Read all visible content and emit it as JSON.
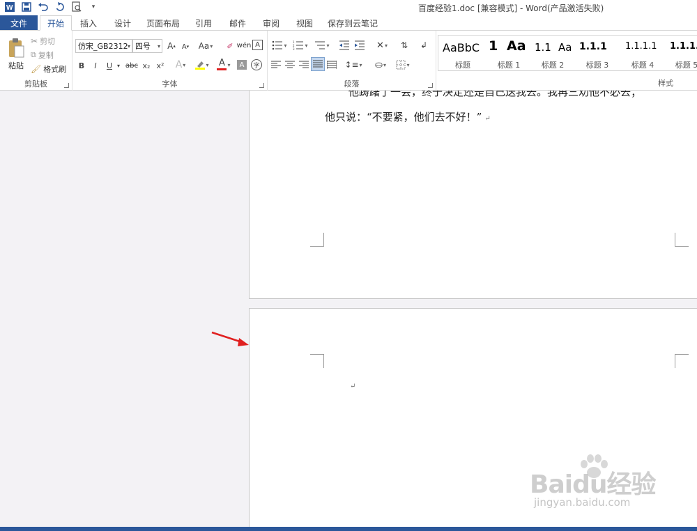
{
  "window": {
    "title": "百度经验1.doc [兼容模式] - Word(产品激活失败)"
  },
  "quick_access": {
    "icons": [
      "word-logo-icon",
      "save-icon",
      "undo-icon",
      "redo-icon",
      "print-preview-icon",
      "customize-qat-icon"
    ]
  },
  "tabs": {
    "file": "文件",
    "items": [
      {
        "label": "开始",
        "active": true
      },
      {
        "label": "插入",
        "active": false
      },
      {
        "label": "设计",
        "active": false
      },
      {
        "label": "页面布局",
        "active": false
      },
      {
        "label": "引用",
        "active": false
      },
      {
        "label": "邮件",
        "active": false
      },
      {
        "label": "审阅",
        "active": false
      },
      {
        "label": "视图",
        "active": false
      },
      {
        "label": "保存到云笔记",
        "active": false
      }
    ]
  },
  "clipboard": {
    "paste": "粘贴",
    "cut": "剪切",
    "copy": "复制",
    "format_painter": "格式刷",
    "group_label": "剪贴板"
  },
  "font": {
    "font_name": "仿宋_GB2312",
    "font_size": "四号",
    "grow": "A",
    "shrink": "A",
    "change_case": "Aa",
    "bold": "B",
    "italic": "I",
    "underline": "U",
    "strikethrough": "abc",
    "subscript": "x₂",
    "superscript": "x²",
    "text_effect": "A",
    "font_color": "A",
    "char_shading": "A",
    "enclose": "字",
    "group_label": "字体"
  },
  "paragraph": {
    "group_label": "段落"
  },
  "styles": {
    "group_label": "样式",
    "items": [
      {
        "preview": "AaBbC",
        "name": "标题"
      },
      {
        "preview": "1",
        "name": "标题 1"
      },
      {
        "preview": "Aa",
        "name": ""
      },
      {
        "preview": "1.1",
        "name": "标题 2"
      },
      {
        "preview": "Aa",
        "name": ""
      },
      {
        "preview": "1.1.1",
        "name": "标题 3"
      },
      {
        "preview": "1.1.1.1",
        "name": "标题 4"
      },
      {
        "preview": "1.1.1.",
        "name": "标题 5"
      }
    ]
  },
  "document": {
    "line1": "他踌躇了一会，终于决定还是自己送我去。我再三劝他不必去；",
    "line2": "他只说：“不要紧，他们去不好！”",
    "paragraph_mark": "↵"
  },
  "watermark": {
    "brand": "Baidu经验",
    "url": "jingyan.baidu.com"
  },
  "colors": {
    "accent": "#2b579a",
    "arrow": "#e02020",
    "highlight": "#ffff00",
    "font_color": "#e02020"
  }
}
